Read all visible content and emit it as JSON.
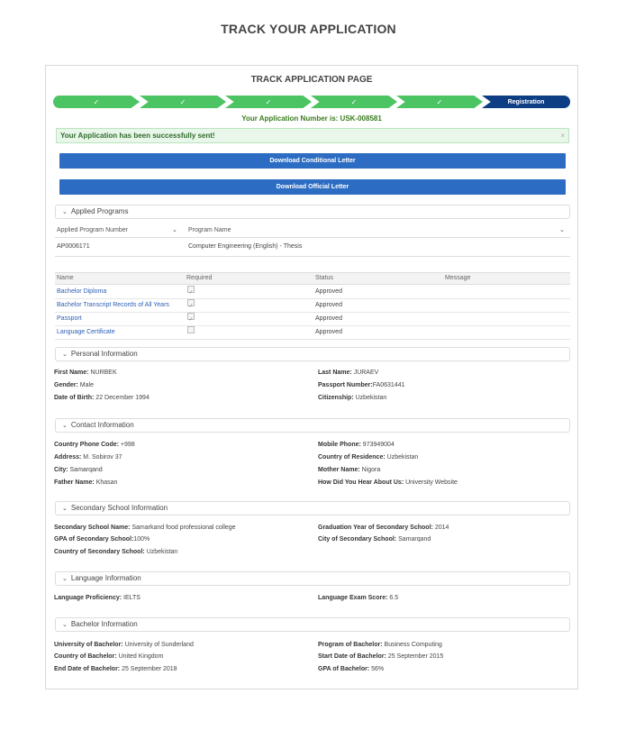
{
  "page_title": "TRACK YOUR APPLICATION",
  "card_title": "TRACK APPLICATION PAGE",
  "steps": [
    {
      "label": "✓",
      "state": "done"
    },
    {
      "label": "✓",
      "state": "done"
    },
    {
      "label": "✓",
      "state": "done"
    },
    {
      "label": "✓",
      "state": "done"
    },
    {
      "label": "✓",
      "state": "done"
    },
    {
      "label": "Registration",
      "state": "current"
    }
  ],
  "colors": {
    "done": "#4cc463",
    "current": "#0d3e84",
    "button": "#2c6cc2",
    "link": "#2c5fb4"
  },
  "application_number_text": "Your Application Number is: USK-008581",
  "alert": {
    "message": "Your Application has been successfully sent!",
    "close": "×"
  },
  "buttons": {
    "conditional": "Download Conditional Letter",
    "official": "Download Official Letter"
  },
  "applied_programs": {
    "header": "Applied Programs",
    "columns": [
      "Applied Program Number",
      "Program Name"
    ],
    "rows": [
      {
        "number": "AP0006171",
        "name": "Computer Engineering (English) - Thesis"
      }
    ]
  },
  "documents": {
    "columns": [
      "Name",
      "Required",
      "Status",
      "Message"
    ],
    "rows": [
      {
        "name": "Bachelor Diploma",
        "required": true,
        "status": "Approved",
        "message": ""
      },
      {
        "name": "Bachelor Transcript Records of All Years",
        "required": true,
        "status": "Approved",
        "message": ""
      },
      {
        "name": "Passport",
        "required": true,
        "status": "Approved",
        "message": ""
      },
      {
        "name": "Language Certificate",
        "required": false,
        "status": "Approved",
        "message": ""
      }
    ]
  },
  "personal": {
    "header": "Personal Information",
    "first_name_label": "First Name:",
    "first_name": "NURBEK",
    "last_name_label": "Last Name:",
    "last_name": "JURAEV",
    "gender_label": "Gender:",
    "gender": "Male",
    "passport_label": "Passport Number:",
    "passport": "FA0631441",
    "dob_label": "Date of Birth:",
    "dob": "22 December 1994",
    "citizenship_label": "Citizenship:",
    "citizenship": "Uzbekistan"
  },
  "contact": {
    "header": "Contact Information",
    "phone_code_label": "Country Phone Code:",
    "phone_code": "+998",
    "mobile_label": "Mobile Phone:",
    "mobile": "973949004",
    "address_label": "Address:",
    "address": "M. Sobirov 37",
    "residence_label": "Country of Residence:",
    "residence": "Uzbekistan",
    "city_label": "City:",
    "city": "Samarqand",
    "mother_label": "Mother Name:",
    "mother": "Nigora",
    "father_label": "Father Name:",
    "father": "Khasan",
    "hear_label": "How Did You Hear About Us:",
    "hear": "University Website"
  },
  "secondary": {
    "header": "Secondary School Information",
    "school_label": "Secondary School Name:",
    "school": "Samarkand food professional college",
    "grad_year_label": "Graduation Year of Secondary School:",
    "grad_year": "2014",
    "gpa_label": "GPA of Secondary School:",
    "gpa": "100%",
    "city_label": "City of Secondary School:",
    "city": "Samarqand",
    "country_label": "Country of Secondary School:",
    "country": "Uzbekistan"
  },
  "language": {
    "header": "Language Information",
    "proficiency_label": "Language Proficiency:",
    "proficiency": "IELTS",
    "score_label": "Language Exam Score:",
    "score": "6.5"
  },
  "bachelor": {
    "header": "Bachelor Information",
    "university_label": "University of Bachelor:",
    "university": "University of Sunderland",
    "program_label": "Program of Bachelor:",
    "program": "Business Computing",
    "country_label": "Country of Bachelor:",
    "country": "United Kingdom",
    "start_label": "Start Date of Bachelor:",
    "start": "25 September 2015",
    "end_label": "End Date of Bachelor:",
    "end": "25 September 2018",
    "gpa_label": "GPA of Bachelor:",
    "gpa": "56%"
  }
}
